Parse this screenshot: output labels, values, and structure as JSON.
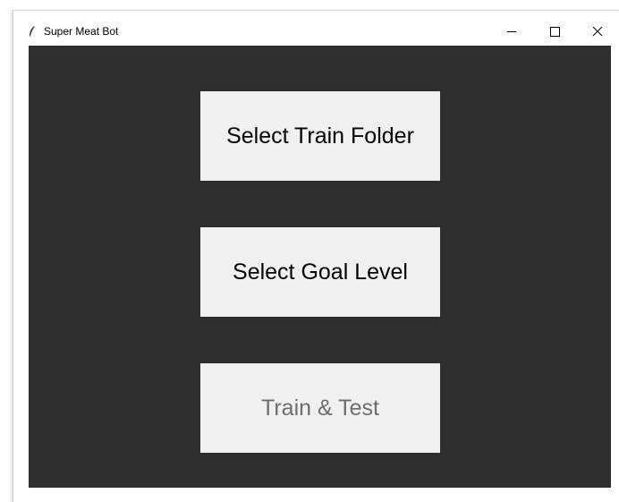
{
  "window": {
    "title": "Super Meat Bot",
    "app_icon": "feather-icon",
    "controls": {
      "minimize_icon": "minimize-icon",
      "maximize_icon": "maximize-icon",
      "close_icon": "close-icon"
    }
  },
  "main": {
    "background_color": "#2f2f2f",
    "buttons": [
      {
        "label": "Select Train Folder",
        "enabled": true
      },
      {
        "label": "Select Goal Level",
        "enabled": true
      },
      {
        "label": "Train & Test",
        "enabled": false
      }
    ]
  }
}
